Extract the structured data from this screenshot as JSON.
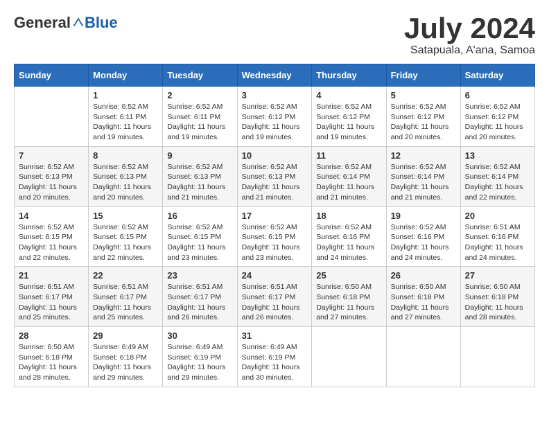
{
  "header": {
    "logo_general": "General",
    "logo_blue": "Blue",
    "month_title": "July 2024",
    "subtitle": "Satapuala, A'ana, Samoa"
  },
  "weekdays": [
    "Sunday",
    "Monday",
    "Tuesday",
    "Wednesday",
    "Thursday",
    "Friday",
    "Saturday"
  ],
  "weeks": [
    [
      {
        "day": "",
        "sunrise": "",
        "sunset": "",
        "daylight": ""
      },
      {
        "day": "1",
        "sunrise": "Sunrise: 6:52 AM",
        "sunset": "Sunset: 6:11 PM",
        "daylight": "Daylight: 11 hours and 19 minutes."
      },
      {
        "day": "2",
        "sunrise": "Sunrise: 6:52 AM",
        "sunset": "Sunset: 6:11 PM",
        "daylight": "Daylight: 11 hours and 19 minutes."
      },
      {
        "day": "3",
        "sunrise": "Sunrise: 6:52 AM",
        "sunset": "Sunset: 6:12 PM",
        "daylight": "Daylight: 11 hours and 19 minutes."
      },
      {
        "day": "4",
        "sunrise": "Sunrise: 6:52 AM",
        "sunset": "Sunset: 6:12 PM",
        "daylight": "Daylight: 11 hours and 19 minutes."
      },
      {
        "day": "5",
        "sunrise": "Sunrise: 6:52 AM",
        "sunset": "Sunset: 6:12 PM",
        "daylight": "Daylight: 11 hours and 20 minutes."
      },
      {
        "day": "6",
        "sunrise": "Sunrise: 6:52 AM",
        "sunset": "Sunset: 6:12 PM",
        "daylight": "Daylight: 11 hours and 20 minutes."
      }
    ],
    [
      {
        "day": "7",
        "sunrise": "Sunrise: 6:52 AM",
        "sunset": "Sunset: 6:13 PM",
        "daylight": "Daylight: 11 hours and 20 minutes."
      },
      {
        "day": "8",
        "sunrise": "Sunrise: 6:52 AM",
        "sunset": "Sunset: 6:13 PM",
        "daylight": "Daylight: 11 hours and 20 minutes."
      },
      {
        "day": "9",
        "sunrise": "Sunrise: 6:52 AM",
        "sunset": "Sunset: 6:13 PM",
        "daylight": "Daylight: 11 hours and 21 minutes."
      },
      {
        "day": "10",
        "sunrise": "Sunrise: 6:52 AM",
        "sunset": "Sunset: 6:13 PM",
        "daylight": "Daylight: 11 hours and 21 minutes."
      },
      {
        "day": "11",
        "sunrise": "Sunrise: 6:52 AM",
        "sunset": "Sunset: 6:14 PM",
        "daylight": "Daylight: 11 hours and 21 minutes."
      },
      {
        "day": "12",
        "sunrise": "Sunrise: 6:52 AM",
        "sunset": "Sunset: 6:14 PM",
        "daylight": "Daylight: 11 hours and 21 minutes."
      },
      {
        "day": "13",
        "sunrise": "Sunrise: 6:52 AM",
        "sunset": "Sunset: 6:14 PM",
        "daylight": "Daylight: 11 hours and 22 minutes."
      }
    ],
    [
      {
        "day": "14",
        "sunrise": "Sunrise: 6:52 AM",
        "sunset": "Sunset: 6:15 PM",
        "daylight": "Daylight: 11 hours and 22 minutes."
      },
      {
        "day": "15",
        "sunrise": "Sunrise: 6:52 AM",
        "sunset": "Sunset: 6:15 PM",
        "daylight": "Daylight: 11 hours and 22 minutes."
      },
      {
        "day": "16",
        "sunrise": "Sunrise: 6:52 AM",
        "sunset": "Sunset: 6:15 PM",
        "daylight": "Daylight: 11 hours and 23 minutes."
      },
      {
        "day": "17",
        "sunrise": "Sunrise: 6:52 AM",
        "sunset": "Sunset: 6:15 PM",
        "daylight": "Daylight: 11 hours and 23 minutes."
      },
      {
        "day": "18",
        "sunrise": "Sunrise: 6:52 AM",
        "sunset": "Sunset: 6:16 PM",
        "daylight": "Daylight: 11 hours and 24 minutes."
      },
      {
        "day": "19",
        "sunrise": "Sunrise: 6:52 AM",
        "sunset": "Sunset: 6:16 PM",
        "daylight": "Daylight: 11 hours and 24 minutes."
      },
      {
        "day": "20",
        "sunrise": "Sunrise: 6:51 AM",
        "sunset": "Sunset: 6:16 PM",
        "daylight": "Daylight: 11 hours and 24 minutes."
      }
    ],
    [
      {
        "day": "21",
        "sunrise": "Sunrise: 6:51 AM",
        "sunset": "Sunset: 6:17 PM",
        "daylight": "Daylight: 11 hours and 25 minutes."
      },
      {
        "day": "22",
        "sunrise": "Sunrise: 6:51 AM",
        "sunset": "Sunset: 6:17 PM",
        "daylight": "Daylight: 11 hours and 25 minutes."
      },
      {
        "day": "23",
        "sunrise": "Sunrise: 6:51 AM",
        "sunset": "Sunset: 6:17 PM",
        "daylight": "Daylight: 11 hours and 26 minutes."
      },
      {
        "day": "24",
        "sunrise": "Sunrise: 6:51 AM",
        "sunset": "Sunset: 6:17 PM",
        "daylight": "Daylight: 11 hours and 26 minutes."
      },
      {
        "day": "25",
        "sunrise": "Sunrise: 6:50 AM",
        "sunset": "Sunset: 6:18 PM",
        "daylight": "Daylight: 11 hours and 27 minutes."
      },
      {
        "day": "26",
        "sunrise": "Sunrise: 6:50 AM",
        "sunset": "Sunset: 6:18 PM",
        "daylight": "Daylight: 11 hours and 27 minutes."
      },
      {
        "day": "27",
        "sunrise": "Sunrise: 6:50 AM",
        "sunset": "Sunset: 6:18 PM",
        "daylight": "Daylight: 11 hours and 28 minutes."
      }
    ],
    [
      {
        "day": "28",
        "sunrise": "Sunrise: 6:50 AM",
        "sunset": "Sunset: 6:18 PM",
        "daylight": "Daylight: 11 hours and 28 minutes."
      },
      {
        "day": "29",
        "sunrise": "Sunrise: 6:49 AM",
        "sunset": "Sunset: 6:18 PM",
        "daylight": "Daylight: 11 hours and 29 minutes."
      },
      {
        "day": "30",
        "sunrise": "Sunrise: 6:49 AM",
        "sunset": "Sunset: 6:19 PM",
        "daylight": "Daylight: 11 hours and 29 minutes."
      },
      {
        "day": "31",
        "sunrise": "Sunrise: 6:49 AM",
        "sunset": "Sunset: 6:19 PM",
        "daylight": "Daylight: 11 hours and 30 minutes."
      },
      {
        "day": "",
        "sunrise": "",
        "sunset": "",
        "daylight": ""
      },
      {
        "day": "",
        "sunrise": "",
        "sunset": "",
        "daylight": ""
      },
      {
        "day": "",
        "sunrise": "",
        "sunset": "",
        "daylight": ""
      }
    ]
  ]
}
